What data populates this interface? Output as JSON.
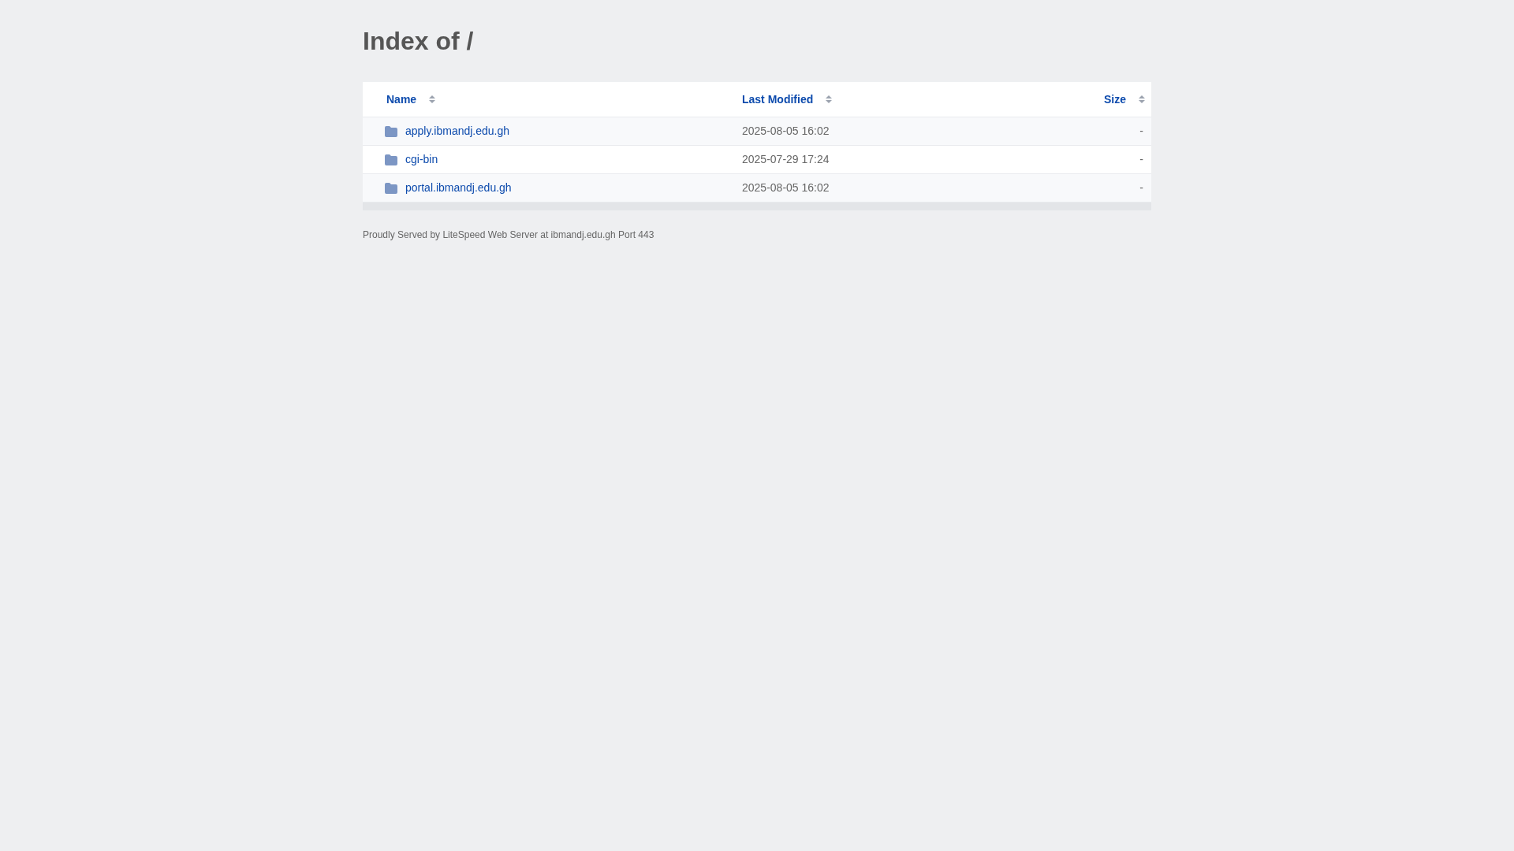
{
  "title": "Index of /",
  "columns": [
    {
      "label": "Name"
    },
    {
      "label": "Last Modified"
    },
    {
      "label": "Size"
    }
  ],
  "rows": [
    {
      "name": "apply.ibmandj.edu.gh",
      "modified": "2025-08-05 16:02",
      "size": "-"
    },
    {
      "name": "cgi-bin",
      "modified": "2025-07-29 17:24",
      "size": "-"
    },
    {
      "name": "portal.ibmandj.edu.gh",
      "modified": "2025-08-05 16:02",
      "size": "-"
    }
  ],
  "footer": "Proudly Served by LiteSpeed Web Server at ibmandj.edu.gh Port 443"
}
